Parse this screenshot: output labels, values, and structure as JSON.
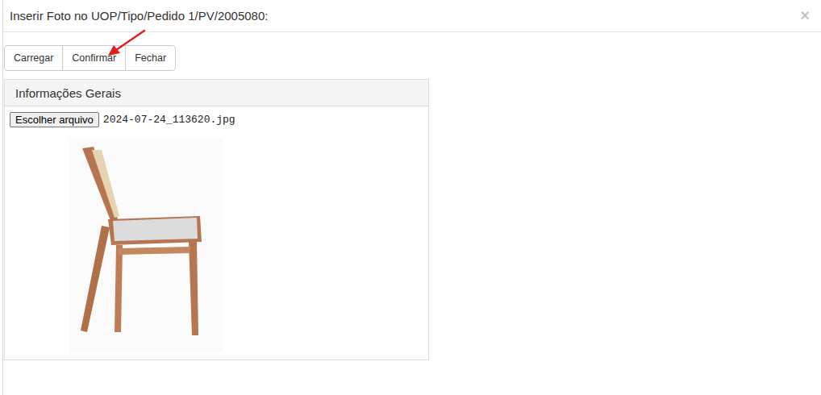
{
  "window": {
    "title": "Inserir Foto no UOP/Tipo/Pedido 1/PV/2005080:",
    "close": "×"
  },
  "toolbar": {
    "buttons": [
      "Carregar",
      "Confirmar",
      "Fechar"
    ]
  },
  "annotation": {
    "kind": "arrow",
    "target": "Confirmar",
    "color": "#e0201e"
  },
  "panel": {
    "title": "Informações Gerais",
    "file_button": "Escolher arquivo",
    "file_name": "2024-07-24_113620.jpg",
    "photo": true
  }
}
